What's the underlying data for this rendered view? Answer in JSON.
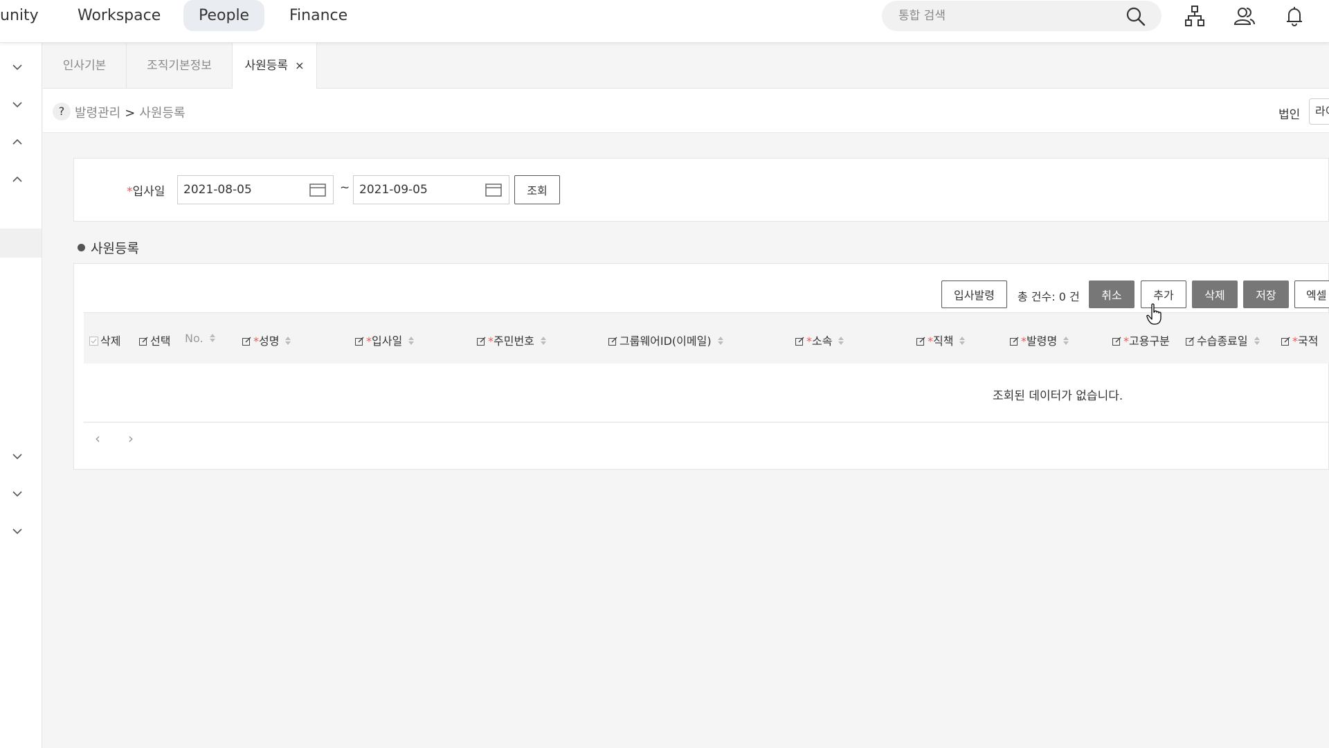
{
  "nav": {
    "items": [
      {
        "label": "unity",
        "active": false
      },
      {
        "label": "Workspace",
        "active": false
      },
      {
        "label": "People",
        "active": true
      },
      {
        "label": "Finance",
        "active": false
      }
    ],
    "search_placeholder": "통합 검색",
    "icons": [
      "search-icon",
      "org-chart-icon",
      "users-icon",
      "bell-icon"
    ]
  },
  "tabs": [
    {
      "label": "인사기본",
      "active": false
    },
    {
      "label": "조직기본정보",
      "active": false
    },
    {
      "label": "사원등록",
      "active": true,
      "close": "×"
    }
  ],
  "breadcrumb": {
    "help": "?",
    "parent": "발령관리",
    "separator": ">",
    "current": "사원등록"
  },
  "corp": {
    "label": "법인",
    "value": "라이"
  },
  "filter": {
    "required_mark": "*",
    "label": "입사일",
    "from": "2021-08-05",
    "tilde": "~",
    "to": "2021-09-05",
    "search_button": "조회"
  },
  "section": {
    "title": "사원등록"
  },
  "toolbar": {
    "issue_button": "입사발령",
    "count_text": "총 건수: 0 건",
    "cancel_button": "취소",
    "add_button": "추가",
    "delete_button": "삭제",
    "save_button": "저장",
    "excel_button": "엑셀"
  },
  "grid": {
    "columns": {
      "delete": "삭제",
      "select": "선택",
      "no": "No.",
      "name": "성명",
      "join_date": "입사일",
      "resident_no": "주민번호",
      "groupware_id": "그룹웨어ID(이메일)",
      "department": "소속",
      "position": "직책",
      "order_name": "발령명",
      "employment_type": "고용구분",
      "probation_end": "수습종료일",
      "nationality": "국적"
    },
    "empty_message": "조회된 데이터가 없습니다.",
    "pager_prev": "‹",
    "pager_next": "›"
  },
  "colors": {
    "accent_nav": "#e9ecf0",
    "required": "#e55555",
    "dark_button": "#777777"
  }
}
